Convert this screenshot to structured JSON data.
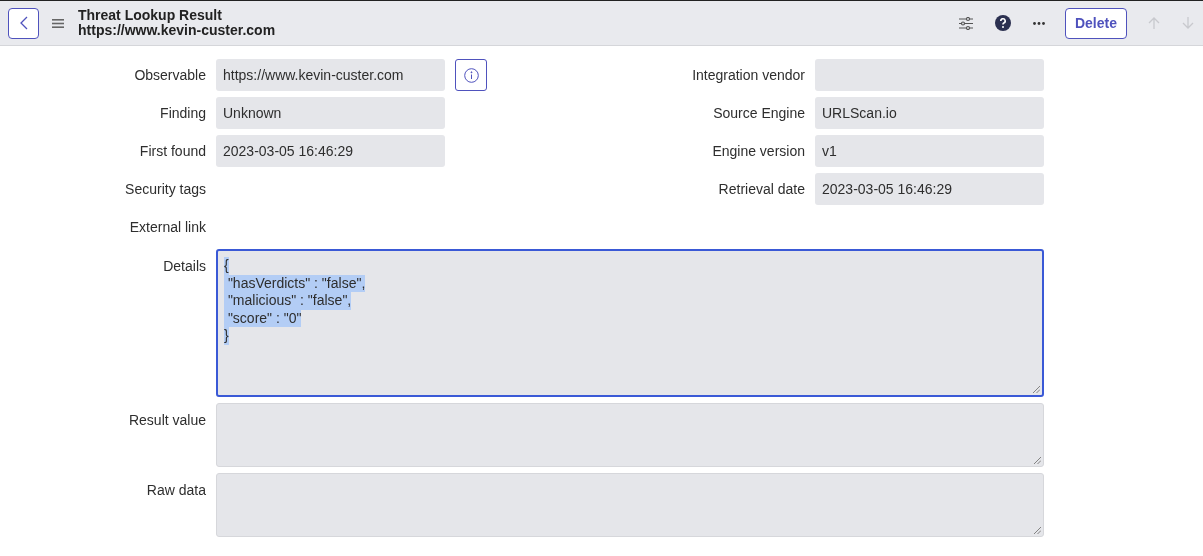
{
  "header": {
    "title": "Threat Lookup Result",
    "subtitle": "https://www.kevin-custer.com",
    "delete_label": "Delete",
    "nav": [
      {
        "kind": "up",
        "disabled": true
      },
      {
        "kind": "down",
        "disabled": true
      }
    ]
  },
  "rows": [
    {
      "left": {
        "label": "Observable",
        "kind": "text",
        "value": "https://www.kevin-custer.com",
        "info_button": true
      },
      "right": {
        "label": "Integration vendor",
        "kind": "text"
      }
    },
    {
      "left": {
        "label": "Finding",
        "kind": "text",
        "value": "Unknown"
      },
      "right": {
        "label": "Source Engine",
        "kind": "text",
        "value": "URLScan.io"
      }
    },
    {
      "left": {
        "label": "First found",
        "kind": "text",
        "value": "2023-03-05 16:46:29"
      },
      "right": {
        "label": "Engine version",
        "kind": "text",
        "value": "v1"
      }
    },
    {
      "left": {
        "label": "Security tags",
        "kind": "none"
      },
      "right": {
        "label": "Retrieval date",
        "kind": "text",
        "value": "2023-03-05 16:46:29"
      }
    },
    {
      "left": {
        "label": "External link",
        "kind": "none"
      }
    }
  ],
  "areas": [
    {
      "label": "Details",
      "kind": "code",
      "focused": true,
      "text_selected": true,
      "lines": [
        "{",
        " \"hasVerdicts\" : \"false\",",
        " \"malicious\" : \"false\",",
        " \"score\" : \"0\"",
        "}"
      ]
    },
    {
      "label": "Result value",
      "kind": "plain",
      "focused": false
    },
    {
      "label": "Raw data",
      "kind": "plain",
      "focused": false
    }
  ]
}
